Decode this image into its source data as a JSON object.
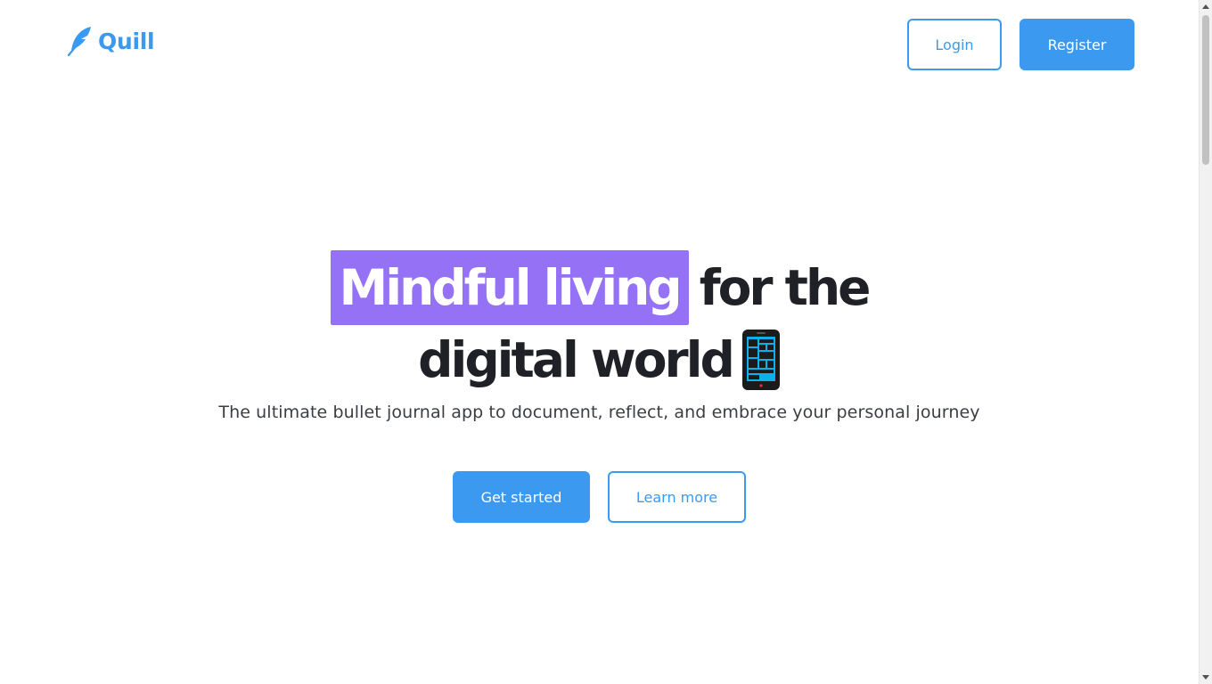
{
  "header": {
    "logo_text": "Quill",
    "login_label": "Login",
    "register_label": "Register"
  },
  "hero": {
    "headline_highlight": "Mindful living",
    "headline_rest_line1": "for the",
    "headline_line2": "digital world",
    "subtitle": "The ultimate bullet journal app to document, reflect, and embrace your personal journey",
    "primary_cta": "Get started",
    "secondary_cta": "Learn more"
  },
  "icons": {
    "logo": "feather-icon",
    "headline_emoji": "mobile-phone-icon"
  },
  "colors": {
    "accent": "#3b9af0",
    "highlight": "#9572f5",
    "heading": "#1f2126",
    "body_text": "#3a3d44"
  }
}
